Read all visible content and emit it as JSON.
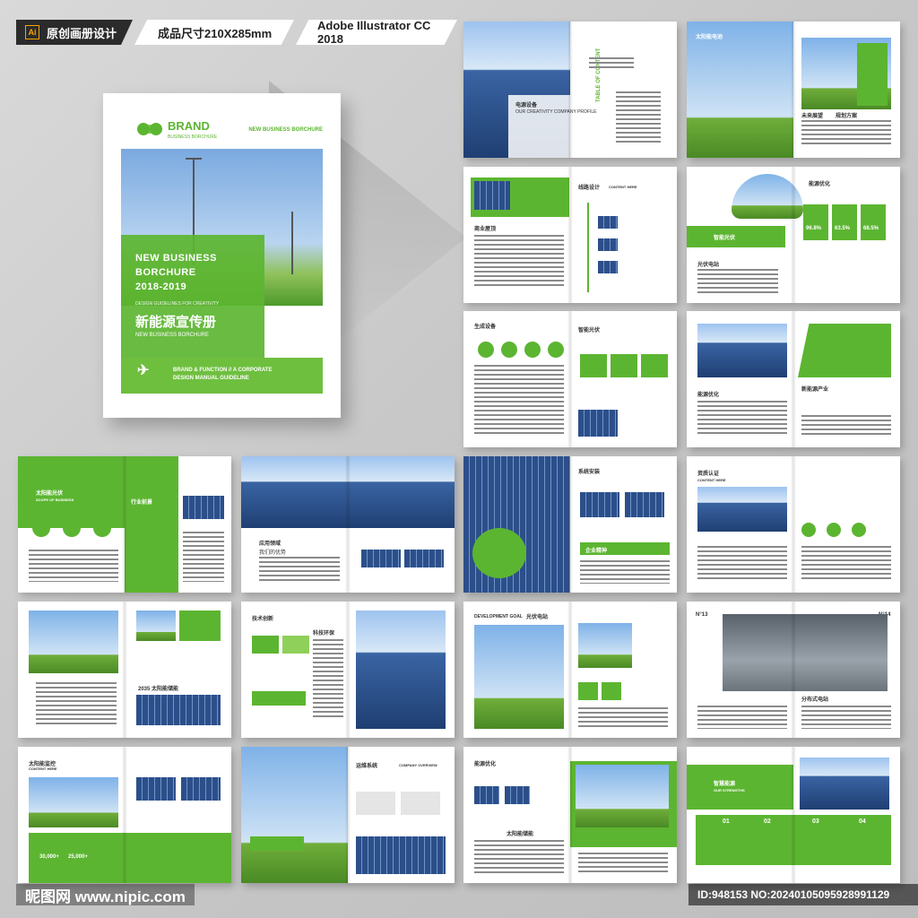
{
  "top_bar": {
    "app_icon": "Ai",
    "title": "原创画册设计",
    "size": "成品尺寸210X285mm",
    "software": "Adobe Illustrator CC 2018"
  },
  "cover": {
    "brand": "BRAND",
    "brand_sub": "BUSINESS BORCHURE",
    "top_right": "NEW BUSINESS BORCHURE",
    "title_line1": "NEW BUSINESS",
    "title_line2": "BORCHURE",
    "title_line3": "2018-2019",
    "guide": "DESIGN GUIDELINES FOR CREATIVITY",
    "title_cn": "新能源宣传册",
    "title_en": "NEW BUSINESS BORCHURE",
    "bottom_line1": "BRAND & FUNCTION // A CORPORATE",
    "bottom_line2": "DESIGN MANUAL GUIDELINE"
  },
  "spreads": {
    "s1": {
      "label": "电源设备",
      "sub": "OUR CREATIVITY COMPANY PROFILE",
      "toc": "TABLE OF CONTENT"
    },
    "s2": {
      "label": "太阳能电池",
      "a": "未来展望",
      "b": "规划方案"
    },
    "s3": {
      "label": "线路设计",
      "a": "商业屋顶",
      "b": "CONTENT HERE"
    },
    "s4": {
      "label": "能源优化",
      "a": "智能光伏",
      "b": "光伏电站",
      "p1": "96.8%",
      "p2": "63.5%",
      "p3": "68.5%"
    },
    "s5": {
      "label": "生成设备",
      "a": "智能光伏"
    },
    "s6": {
      "label": "能源优化",
      "a": "新能源产业"
    },
    "s7": {
      "label": "太阳能光伏",
      "a": "SCOPE OF BUSINESS",
      "b": "行业前景"
    },
    "s8": {
      "label": "应用领域",
      "a": "我们的优势"
    },
    "s9": {
      "label": "系统安装",
      "a": "企业精神"
    },
    "s10": {
      "label": "资质认证",
      "a": "CONTENT HERE"
    },
    "s11": {
      "label": "2035 太阳能储能"
    },
    "s12": {
      "label": "技术创新",
      "a": "科技环保"
    },
    "s13": {
      "label": "DEVELOPMENT GOAL",
      "a": "光伏电站"
    },
    "s14": {
      "label": "分布式电站",
      "a": "N°13",
      "b": "N°14"
    },
    "s15": {
      "label": "太阳能监控",
      "a": "CONTENT HERE",
      "n1": "30,000+",
      "n2": "25,000+"
    },
    "s16": {
      "label": "运维系统",
      "a": "COMPANY OVERVIEW"
    },
    "s17": {
      "label": "能源优化",
      "a": "太阳能储能"
    },
    "s18": {
      "label": "智慧能源",
      "a": "OUR STRENGTHS",
      "n1": "01",
      "n2": "02",
      "n3": "03",
      "n4": "04"
    }
  },
  "footer": {
    "watermark": "昵图网 www.nipic.com",
    "id_text": "ID:948153 NO:20240105095928991129"
  },
  "colors": {
    "accent": "#5cb531",
    "accent_light": "#8fd05a",
    "dark": "#2b2b2b"
  }
}
